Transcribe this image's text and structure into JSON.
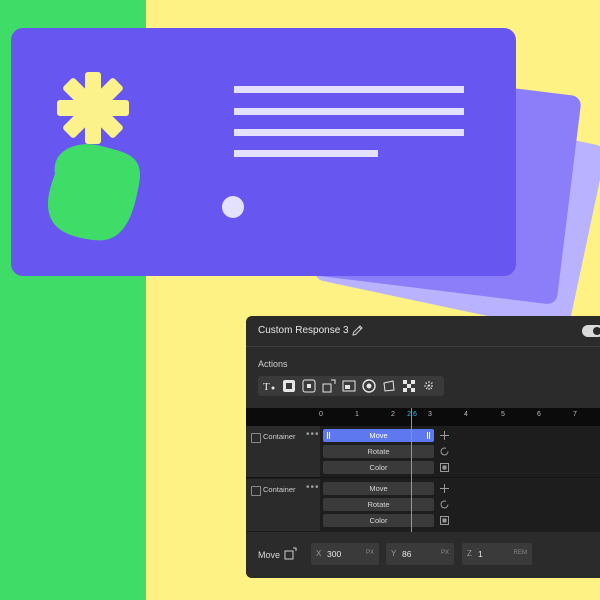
{
  "panel": {
    "title": "Custom Response 3",
    "actions_label": "Actions",
    "toggle_on": true,
    "toolbar_icons": [
      "text-trigger-icon",
      "stop-icon",
      "pause-icon",
      "scale-icon",
      "resize-icon",
      "spin-icon",
      "corner-pin-icon",
      "opacity-icon",
      "sparkle-icon"
    ]
  },
  "timeline": {
    "ruler_labels": [
      "0",
      "1",
      "2",
      "2.6",
      "3",
      "4",
      "5",
      "6",
      "7"
    ],
    "playhead_label": "2.6",
    "groups": [
      {
        "label": "Container",
        "tracks": [
          {
            "label": "Move",
            "icon": "move-icon",
            "selected": true
          },
          {
            "label": "Rotate",
            "icon": "rotate-icon",
            "selected": false
          },
          {
            "label": "Color",
            "icon": "color-icon",
            "selected": false
          }
        ]
      },
      {
        "label": "Container",
        "tracks": [
          {
            "label": "Move",
            "icon": "move-icon",
            "selected": false
          },
          {
            "label": "Rotate",
            "icon": "rotate-icon",
            "selected": false
          },
          {
            "label": "Color",
            "icon": "color-icon",
            "selected": false
          }
        ]
      }
    ]
  },
  "footer": {
    "label": "Move",
    "fields": [
      {
        "axis": "X",
        "value": "300",
        "unit": "PX"
      },
      {
        "axis": "Y",
        "value": "86",
        "unit": "PX"
      },
      {
        "axis": "Z",
        "value": "1",
        "unit": "REM"
      }
    ]
  },
  "colors": {
    "green": "#3fdd68",
    "yellow": "#fef285",
    "card_front": "#6756f0",
    "accent_blue": "#5e79f0",
    "playhead": "#39b6e8"
  }
}
